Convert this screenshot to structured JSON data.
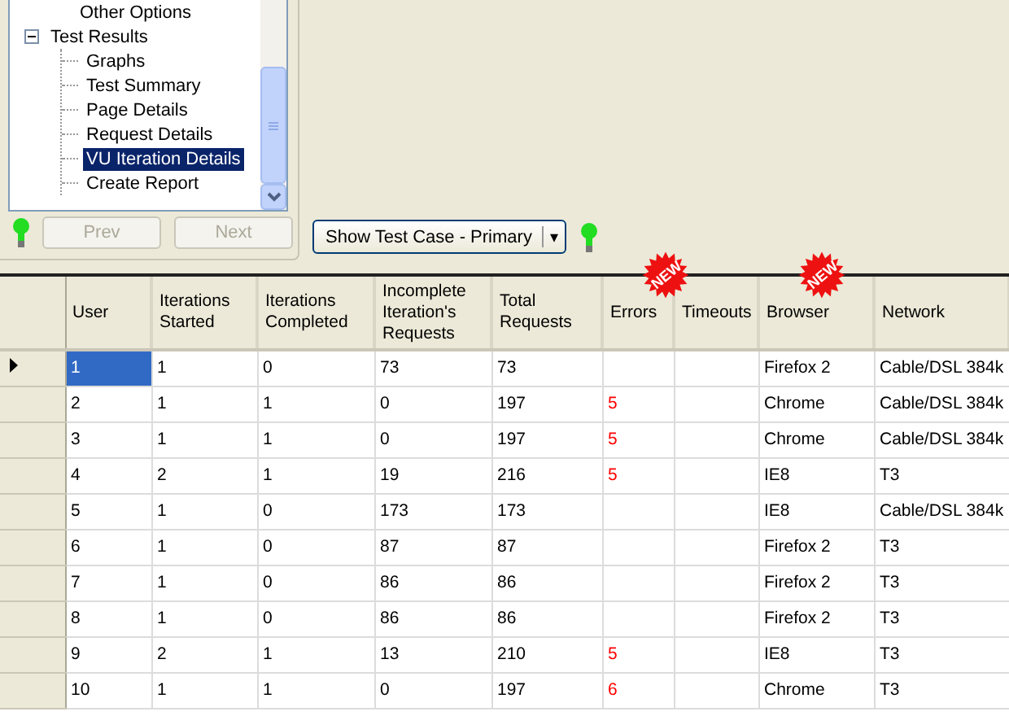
{
  "tree": {
    "items": [
      {
        "label": "Other Options",
        "selected": false
      },
      {
        "label": "Test Results",
        "selected": false,
        "expanded": true,
        "children": [
          {
            "label": "Graphs",
            "selected": false
          },
          {
            "label": "Test Summary",
            "selected": false
          },
          {
            "label": "Page Details",
            "selected": false
          },
          {
            "label": "Request Details",
            "selected": false
          },
          {
            "label": "VU Iteration Details",
            "selected": true
          },
          {
            "label": "Create Report",
            "selected": false
          }
        ]
      }
    ]
  },
  "nav_buttons": [
    {
      "label": "Prev",
      "disabled": true
    },
    {
      "label": "Next",
      "disabled": true
    }
  ],
  "view_selector": {
    "label": "Show Test Case - Primary",
    "arrow": "▾"
  },
  "table": {
    "columns": [
      {
        "label": "User"
      },
      {
        "label": "Iterations Started"
      },
      {
        "label": "Iterations Completed"
      },
      {
        "label": "Incomplete Iteration's Requests"
      },
      {
        "label": "Total Requests"
      },
      {
        "label": "Errors",
        "badge": "NEW"
      },
      {
        "label": "Timeouts"
      },
      {
        "label": "Browser",
        "badge": "NEW"
      },
      {
        "label": "Network"
      }
    ],
    "rows": [
      {
        "selected": true,
        "cells": [
          "1",
          "1",
          "0",
          "73",
          "73",
          "",
          "",
          "Firefox 2",
          "Cable/DSL 384k"
        ]
      },
      {
        "selected": false,
        "cells": [
          "2",
          "1",
          "1",
          "0",
          "197",
          "5",
          "",
          "Chrome",
          "Cable/DSL 384k"
        ]
      },
      {
        "selected": false,
        "cells": [
          "3",
          "1",
          "1",
          "0",
          "197",
          "5",
          "",
          "Chrome",
          "Cable/DSL 384k"
        ]
      },
      {
        "selected": false,
        "cells": [
          "4",
          "2",
          "1",
          "19",
          "216",
          "5",
          "",
          "IE8",
          "T3"
        ]
      },
      {
        "selected": false,
        "cells": [
          "5",
          "1",
          "0",
          "173",
          "173",
          "",
          "",
          "IE8",
          "Cable/DSL 384k"
        ]
      },
      {
        "selected": false,
        "cells": [
          "6",
          "1",
          "0",
          "87",
          "87",
          "",
          "",
          "Firefox 2",
          "T3"
        ]
      },
      {
        "selected": false,
        "cells": [
          "7",
          "1",
          "0",
          "86",
          "86",
          "",
          "",
          "Firefox 2",
          "T3"
        ]
      },
      {
        "selected": false,
        "cells": [
          "8",
          "1",
          "0",
          "86",
          "86",
          "",
          "",
          "Firefox 2",
          "T3"
        ]
      },
      {
        "selected": false,
        "cells": [
          "9",
          "2",
          "1",
          "13",
          "210",
          "5",
          "",
          "IE8",
          "T3"
        ]
      },
      {
        "selected": false,
        "cells": [
          "10",
          "1",
          "1",
          "0",
          "197",
          "6",
          "",
          "Chrome",
          "T3"
        ]
      }
    ]
  }
}
